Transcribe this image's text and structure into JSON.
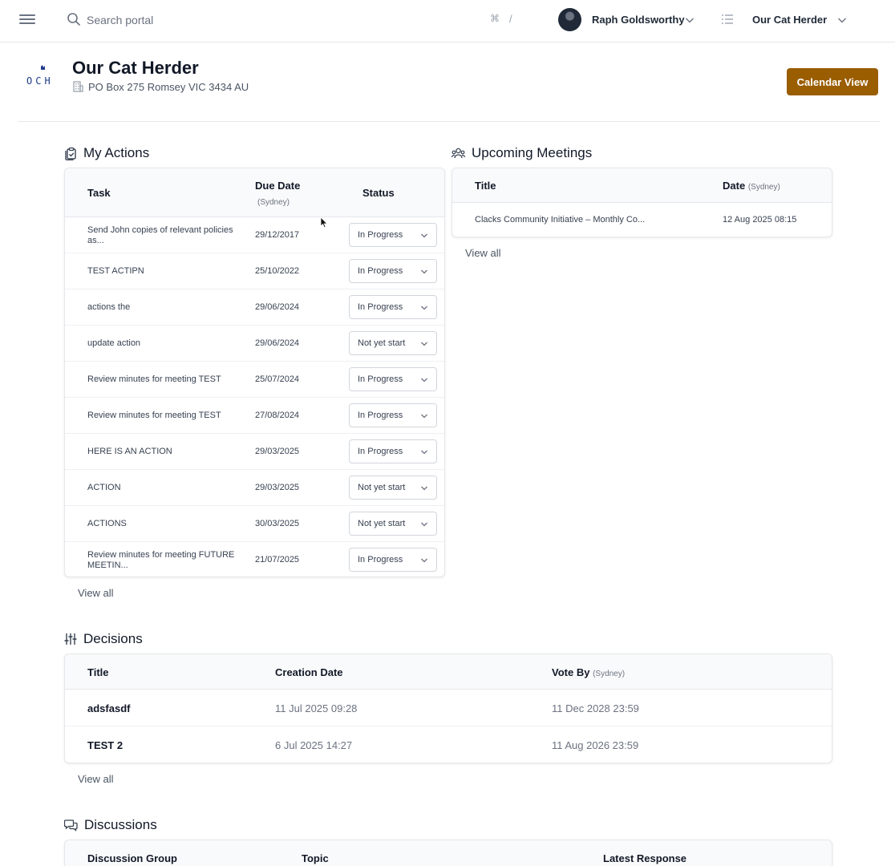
{
  "topbar": {
    "search_placeholder": "Search portal",
    "shortcut_key": "⌘",
    "shortcut_slash": "/",
    "user_name": "Raph Goldsworthy",
    "org_name": "Our Cat Herder"
  },
  "org": {
    "logo_text": "OCH",
    "title": "Our Cat Herder",
    "address": "PO Box 275 Romsey VIC 3434 AU",
    "calendar_button": "Calendar View"
  },
  "actions": {
    "heading": "My Actions",
    "col_task": "Task",
    "col_due": "Due Date",
    "col_due_tz": "(Sydney)",
    "col_status": "Status",
    "rows": [
      {
        "task": "Send John copies of relevant policies as...",
        "due": "29/12/2017",
        "status": "In Progress"
      },
      {
        "task": "TEST ACTIPN",
        "due": "25/10/2022",
        "status": "In Progress"
      },
      {
        "task": "actions the",
        "due": "29/06/2024",
        "status": "In Progress"
      },
      {
        "task": "update action",
        "due": "29/06/2024",
        "status": "Not yet start"
      },
      {
        "task": "Review minutes for meeting TEST",
        "due": "25/07/2024",
        "status": "In Progress"
      },
      {
        "task": "Review minutes for meeting TEST",
        "due": "27/08/2024",
        "status": "In Progress"
      },
      {
        "task": "HERE IS AN ACTION",
        "due": "29/03/2025",
        "status": "In Progress"
      },
      {
        "task": "ACTION",
        "due": "29/03/2025",
        "status": "Not yet start"
      },
      {
        "task": "ACTIONS",
        "due": "30/03/2025",
        "status": "Not yet start"
      },
      {
        "task": "Review minutes for meeting FUTURE MEETIN...",
        "due": "21/07/2025",
        "status": "In Progress"
      }
    ],
    "view_all": "View all"
  },
  "meetings": {
    "heading": "Upcoming Meetings",
    "col_title": "Title",
    "col_date": "Date",
    "col_date_tz": "(Sydney)",
    "rows": [
      {
        "title": "Clacks Community Initiative – Monthly Co...",
        "date": "12 Aug 2025 08:15"
      }
    ],
    "view_all": "View all"
  },
  "decisions": {
    "heading": "Decisions",
    "col_title": "Title",
    "col_created": "Creation Date",
    "col_vote": "Vote By",
    "col_vote_tz": "(Sydney)",
    "rows": [
      {
        "title": "adsfasdf",
        "created": "11 Jul 2025 09:28",
        "vote_by": "11 Dec 2028 23:59"
      },
      {
        "title": "TEST 2",
        "created": "6 Jul 2025 14:27",
        "vote_by": "11 Aug 2026 23:59"
      }
    ],
    "view_all": "View all"
  },
  "discussions": {
    "heading": "Discussions",
    "col_group": "Discussion Group",
    "col_topic": "Topic",
    "col_latest": "Latest Response"
  },
  "colors": {
    "accent": "#9a5d00",
    "border": "#e5e7eb",
    "header_bg": "#f9fafb"
  }
}
